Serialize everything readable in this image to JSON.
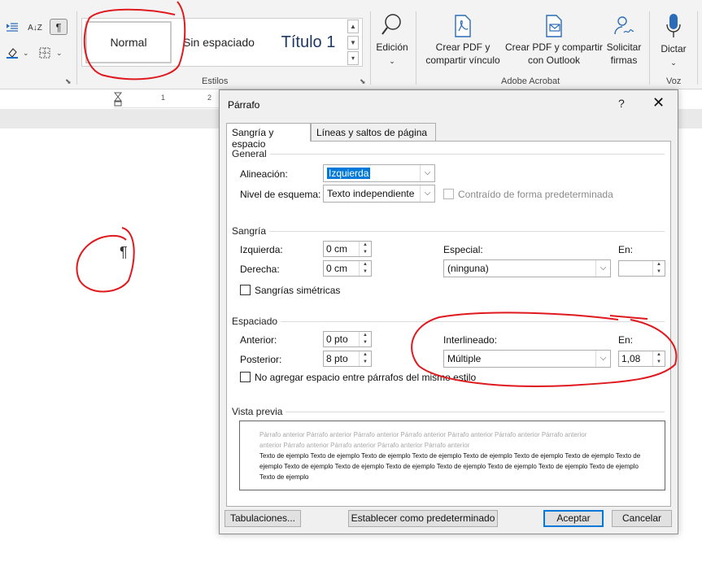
{
  "ribbon": {
    "styles": {
      "normal": "Normal",
      "sin_espaciado": "Sin espaciado",
      "titulo1": "Título 1",
      "group_label": "Estilos"
    },
    "edicion": "Edición",
    "acrobat": {
      "crear_pdf_line1": "Crear PDF y",
      "crear_pdf_line2": "compartir vínculo",
      "outlook_line1": "Crear PDF y compartir",
      "outlook_line2": "con Outlook",
      "solicitar_line1": "Solicitar",
      "solicitar_line2": "firmas",
      "group_label": "Adobe Acrobat"
    },
    "voz": {
      "dictar": "Dictar",
      "group_label": "Voz"
    },
    "pilcrow": "¶",
    "sort_icon_text": "A↓Z"
  },
  "ruler": {
    "ticks": [
      "1",
      "2"
    ]
  },
  "document": {
    "pilcrow": "¶"
  },
  "dialog": {
    "title": "Párrafo",
    "help": "?",
    "close": "✕",
    "tabs": [
      "Sangría y espacio",
      "Líneas y saltos de página"
    ],
    "general": {
      "section": "General",
      "alineacion_label": "Alineación:",
      "alineacion_value": "Izquierda",
      "nivel_label": "Nivel de esquema:",
      "nivel_value": "Texto independiente",
      "contraido_label": "Contraído de forma predeterminada"
    },
    "sangria": {
      "section": "Sangría",
      "izquierda_label": "Izquierda:",
      "izquierda_value": "0 cm",
      "derecha_label": "Derecha:",
      "derecha_value": "0 cm",
      "especial_label": "Especial:",
      "especial_value": "(ninguna)",
      "en_label": "En:",
      "en_value": "",
      "simetricas_label": "Sangrías simétricas"
    },
    "espaciado": {
      "section": "Espaciado",
      "anterior_label": "Anterior:",
      "anterior_value": "0 pto",
      "posterior_label": "Posterior:",
      "posterior_value": "8 pto",
      "interlineado_label": "Interlineado:",
      "interlineado_value": "Múltiple",
      "en_label": "En:",
      "en_value": "1,08",
      "no_agregar_label": "No agregar espacio entre párrafos del mismo estilo"
    },
    "preview": {
      "section": "Vista previa",
      "prev_line1": "Párrafo anterior Párrafo anterior Párrafo anterior Párrafo anterior Párrafo anterior Párrafo anterior Párrafo anterior",
      "prev_line2": "anterior Párrafo anterior Párrafo anterior Párrafo anterior Párrafo anterior",
      "sample_line1": "Texto de ejemplo Texto de ejemplo Texto de ejemplo Texto de ejemplo Texto de ejemplo Texto de ejemplo Texto de ejemplo Texto de",
      "sample_line2": "ejemplo Texto de ejemplo Texto de ejemplo Texto de ejemplo Texto de ejemplo Texto de ejemplo Texto de ejemplo Texto de ejemplo",
      "sample_line3": "Texto de ejemplo"
    },
    "buttons": {
      "tabulaciones": "Tabulaciones...",
      "predeterminado": "Establecer como predeterminado",
      "aceptar": "Aceptar",
      "cancelar": "Cancelar"
    }
  },
  "colors": {
    "accent": "#0078d7",
    "annotation": "#e0191e",
    "acrobat_icon": "#2b6cb8"
  }
}
